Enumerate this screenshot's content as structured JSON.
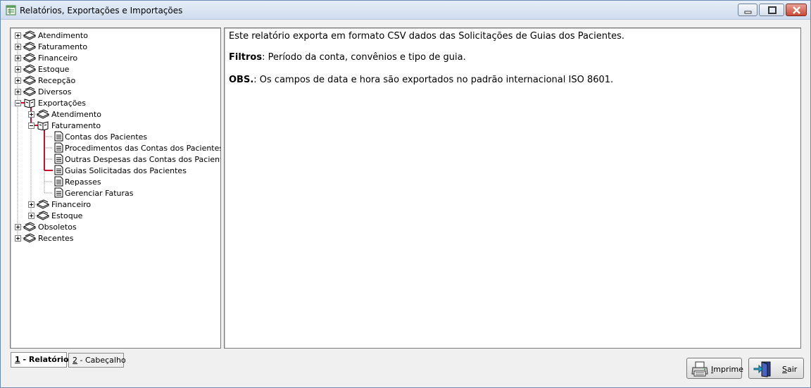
{
  "window": {
    "title": "Relatórios, Exportações e Importações"
  },
  "tree": {
    "items": [
      {
        "label": "Atendimento",
        "expander": "plus",
        "icon": "books-icon"
      },
      {
        "label": "Faturamento",
        "expander": "plus",
        "icon": "books-icon"
      },
      {
        "label": "Financeiro",
        "expander": "plus",
        "icon": "books-icon"
      },
      {
        "label": "Estoque",
        "expander": "plus",
        "icon": "books-icon"
      },
      {
        "label": "Recepção",
        "expander": "plus",
        "icon": "books-icon"
      },
      {
        "label": "Diversos",
        "expander": "plus",
        "icon": "books-icon"
      },
      {
        "label": "Exportações",
        "expander": "minus",
        "icon": "open-book-icon",
        "children": [
          {
            "label": "Atendimento",
            "expander": "plus",
            "icon": "books-icon"
          },
          {
            "label": "Faturamento",
            "expander": "minus",
            "icon": "open-book-icon",
            "children": [
              {
                "label": "Contas dos Pacientes",
                "icon": "document-icon"
              },
              {
                "label": "Procedimentos das Contas dos Pacientes",
                "icon": "document-icon"
              },
              {
                "label": "Outras Despesas das Contas dos Pacientes",
                "icon": "document-icon"
              },
              {
                "label": "Guias Solicitadas dos Pacientes",
                "icon": "document-icon",
                "selected": true
              },
              {
                "label": "Repasses",
                "icon": "document-icon"
              },
              {
                "label": "Gerenciar Faturas",
                "icon": "document-icon"
              }
            ]
          },
          {
            "label": "Financeiro",
            "expander": "plus",
            "icon": "books-icon"
          },
          {
            "label": "Estoque",
            "expander": "plus",
            "icon": "books-icon"
          }
        ]
      },
      {
        "label": "Obsoletos",
        "expander": "plus",
        "icon": "books-icon"
      },
      {
        "label": "Recentes",
        "expander": "plus",
        "icon": "books-icon"
      }
    ]
  },
  "description": {
    "line1": "Este relatório exporta em formato CSV dados das Solicitações de Guias dos Pacientes.",
    "filters_label": "Filtros",
    "filters_text": ": Período da conta, convênios e tipo de guia.",
    "obs_label": "OBS.",
    "obs_text": ": Os campos de data e hora são exportados no padrão internacional  ISO 8601."
  },
  "tabs": [
    {
      "key": "1",
      "label": " - Relatório",
      "active": true
    },
    {
      "key": "2",
      "label": " - Cabeçalho",
      "active": false
    }
  ],
  "buttons": {
    "print_key": "I",
    "print_rest": "mprime",
    "exit_key": "S",
    "exit_rest": "air"
  },
  "colors": {
    "selection_line": "#c8102e",
    "title_bg": "#dde7f3"
  }
}
